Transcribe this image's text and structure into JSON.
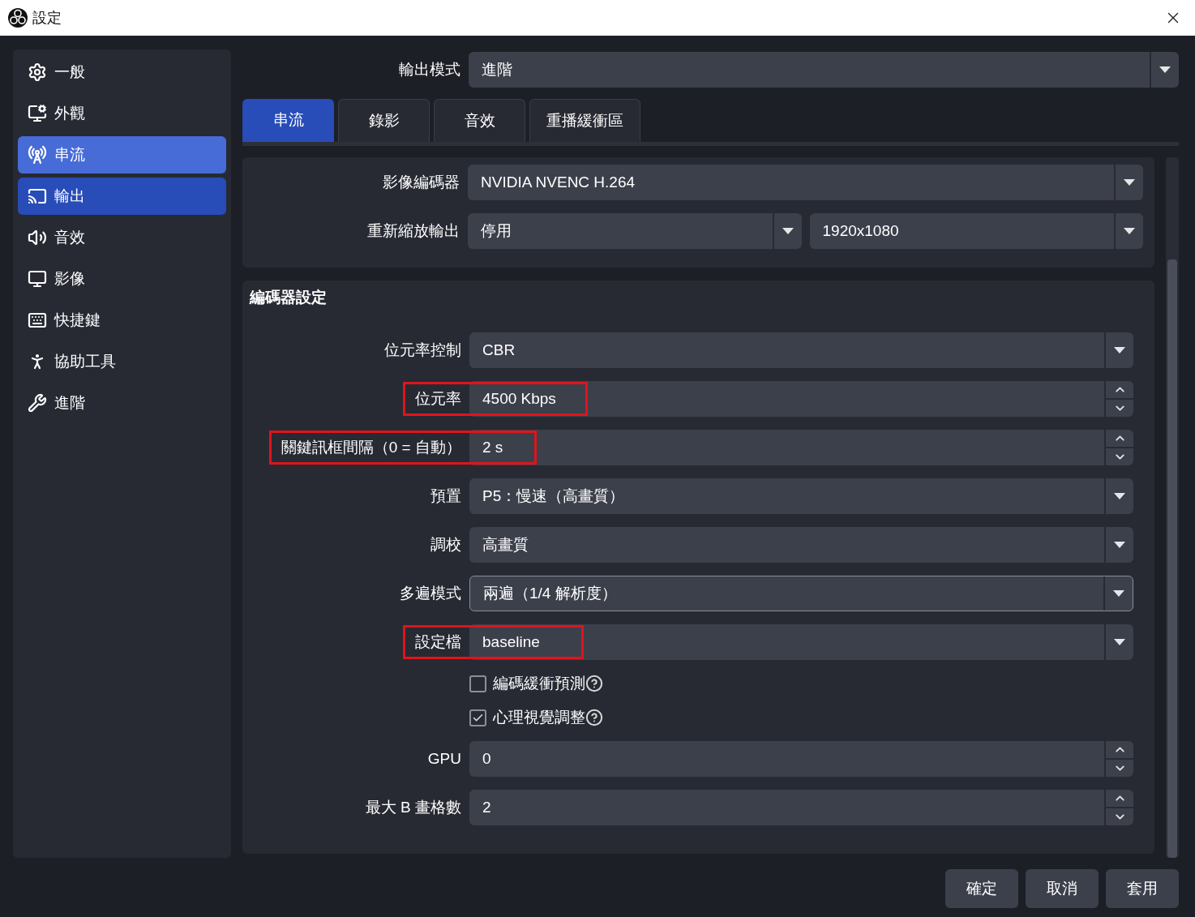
{
  "window": {
    "title": "設定"
  },
  "sidebar": {
    "items": [
      {
        "label": "一般",
        "selected": false,
        "hovered": false
      },
      {
        "label": "外觀",
        "selected": false,
        "hovered": false
      },
      {
        "label": "串流",
        "selected": false,
        "hovered": true
      },
      {
        "label": "輸出",
        "selected": true,
        "hovered": false
      },
      {
        "label": "音效",
        "selected": false,
        "hovered": false
      },
      {
        "label": "影像",
        "selected": false,
        "hovered": false
      },
      {
        "label": "快捷鍵",
        "selected": false,
        "hovered": false
      },
      {
        "label": "協助工具",
        "selected": false,
        "hovered": false
      },
      {
        "label": "進階",
        "selected": false,
        "hovered": false
      }
    ]
  },
  "output_mode": {
    "label": "輸出模式",
    "value": "進階"
  },
  "tabs": [
    {
      "label": "串流",
      "selected": true
    },
    {
      "label": "錄影",
      "selected": false
    },
    {
      "label": "音效",
      "selected": false
    },
    {
      "label": "重播緩衝區",
      "selected": false
    }
  ],
  "general_panel": {
    "rows": [
      {
        "label": "影像編碼器",
        "fields": [
          "NVIDIA NVENC H.264"
        ]
      },
      {
        "label": "重新縮放輸出",
        "fields": [
          "停用",
          "1920x1080"
        ]
      }
    ]
  },
  "encoder_settings": {
    "title": "編碼器設定",
    "rows": [
      {
        "kind": "select",
        "label": "位元率控制",
        "value": "CBR",
        "highlighted": false,
        "focused": false
      },
      {
        "kind": "spinbox",
        "label": "位元率",
        "value": "4500 Kbps",
        "highlighted": true,
        "focused": false
      },
      {
        "kind": "spinbox",
        "label": "關鍵訊框間隔（0 = 自動）",
        "value": "2 s",
        "highlighted": true,
        "focused": false
      },
      {
        "kind": "select",
        "label": "預置",
        "value": "P5：慢速（高畫質）",
        "highlighted": false,
        "focused": false
      },
      {
        "kind": "select",
        "label": "調校",
        "value": "高畫質",
        "highlighted": false,
        "focused": false
      },
      {
        "kind": "select",
        "label": "多遍模式",
        "value": "兩遍（1/4 解析度）",
        "highlighted": false,
        "focused": true
      },
      {
        "kind": "select",
        "label": "設定檔",
        "value": "baseline",
        "highlighted": true,
        "focused": false
      },
      {
        "kind": "checkbox",
        "label": "編碼緩衝預測",
        "checked": false
      },
      {
        "kind": "checkbox",
        "label": "心理視覺調整",
        "checked": true
      },
      {
        "kind": "spinbox",
        "label": "GPU",
        "value": "0",
        "highlighted": false,
        "focused": false
      },
      {
        "kind": "spinbox",
        "label": "最大 B 畫格數",
        "value": "2",
        "highlighted": false,
        "focused": false
      }
    ]
  },
  "buttons": [
    "確定",
    "取消",
    "套用"
  ]
}
